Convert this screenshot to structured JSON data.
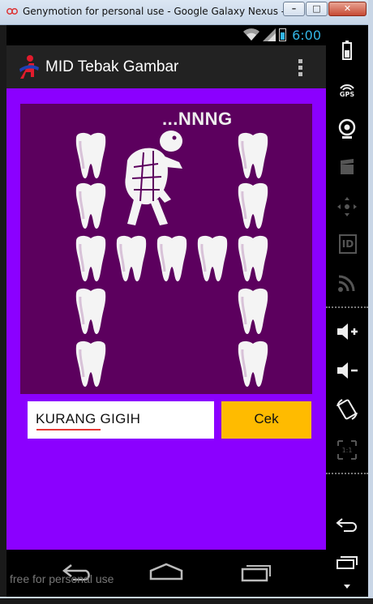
{
  "window": {
    "title": "Genymotion for personal use - Google Galaxy Nexus - 4.3 ...",
    "buttons": {
      "minimize": "–",
      "maximize": "□",
      "close": "✕"
    }
  },
  "status_bar": {
    "time": "6:00"
  },
  "action_bar": {
    "app_title": "MID Tebak Gambar"
  },
  "puzzle": {
    "hint_text": "...NNNG"
  },
  "answer": {
    "value": "KURANG GIGIH"
  },
  "check_button": {
    "label": "Cek"
  },
  "watermark": "free for personal use",
  "side_panel": {
    "gps_label": "GPS",
    "id_label": "ID"
  },
  "colors": {
    "content_bg": "#8b00ff",
    "puzzle_bg": "#5c005e",
    "button_bg": "#ffbb00",
    "clock": "#33b5e5"
  }
}
